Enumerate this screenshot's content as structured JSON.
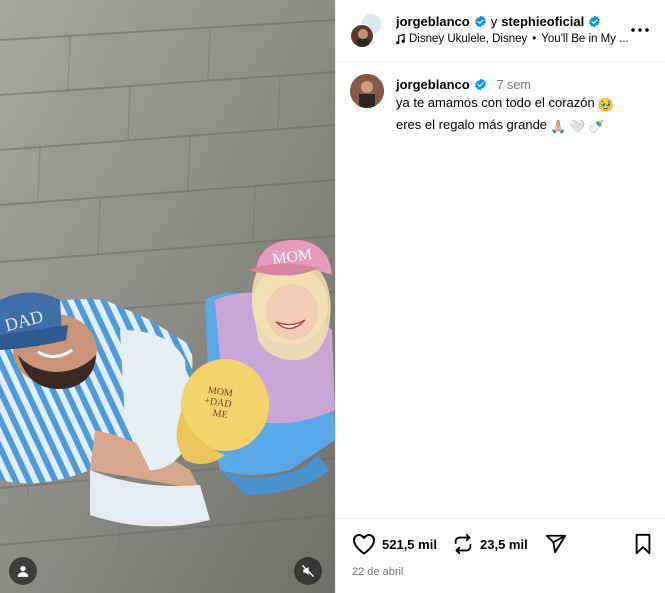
{
  "header": {
    "author": "jorgeblanco",
    "conjunction": "y",
    "collaborator": "stephieoficial",
    "audio_artist": "Disney Ukulele, Disney",
    "audio_track": "You'll Be in My ...",
    "more_icon": "more-horizontal-icon"
  },
  "caption": {
    "username": "jorgeblanco",
    "time_ago": "7 sem",
    "line1": "ya te amamos con todo el corazón",
    "line1_emoji": "🥹",
    "line2": "eres el regalo más grande",
    "line2_emojis": [
      "🙏🏼",
      "🤍",
      "🍼"
    ]
  },
  "actions": {
    "likes": "521,5 mil",
    "reposts": "23,5 mil",
    "date": "22 de abril"
  },
  "media": {
    "cap_blue_text": "DAD",
    "cap_pink_text": "MOM",
    "cap_yellow_text": "MOM\n+DAD\nME"
  },
  "colors": {
    "verified": "#0095f6",
    "secondary_text": "#737373",
    "divider": "#efefef"
  }
}
